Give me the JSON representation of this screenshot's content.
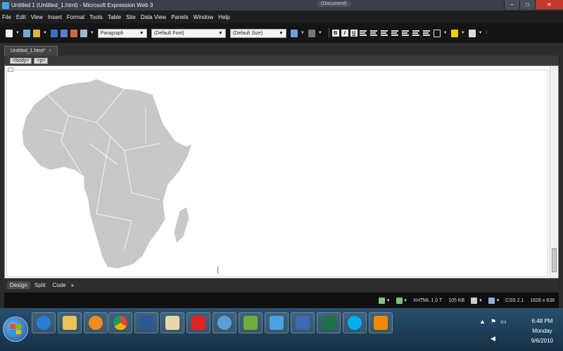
{
  "window": {
    "title": "Untitled 1 (Untitled_1.html) - Microsoft Expression Web 3",
    "center_label": "(Document)",
    "controls": {
      "minimize": "–",
      "maximize": "□",
      "close": "✕"
    }
  },
  "menu": [
    "File",
    "Edit",
    "View",
    "Insert",
    "Format",
    "Tools",
    "Table",
    "Site",
    "Data View",
    "Panels",
    "Window",
    "Help"
  ],
  "toolbar": {
    "style_select": "Paragraph",
    "font_select": "(Default Font)",
    "size_select": "(Default Size)",
    "format_buttons": {
      "bold": "B",
      "italic": "I",
      "underline": "U"
    },
    "overflow": "⁞"
  },
  "doc_tab": {
    "label": "Untitled_1.html*",
    "close": "×"
  },
  "breadcrumb": [
    "<body>",
    "<p>"
  ],
  "view_tabs": {
    "design": "Design",
    "split": "Split",
    "code": "Code"
  },
  "statusbar": {
    "doctype": "XHTML 1.0 T",
    "size": "105 KB",
    "css": "CSS 2.1",
    "dimensions": "1626 x 638"
  },
  "clock": {
    "time": "6:48 PM",
    "day": "Monday",
    "date": "9/6/2010"
  },
  "icons": {
    "new": "new-page-icon",
    "open": "open-folder-icon",
    "save": "save-icon",
    "undo": "undo-icon",
    "redo": "redo-icon",
    "browser": "preview-browser-icon",
    "colors": {
      "accent": "#4aa3df",
      "map_fill": "#c8c8c8",
      "status_bg": "#0f0f0f"
    }
  }
}
